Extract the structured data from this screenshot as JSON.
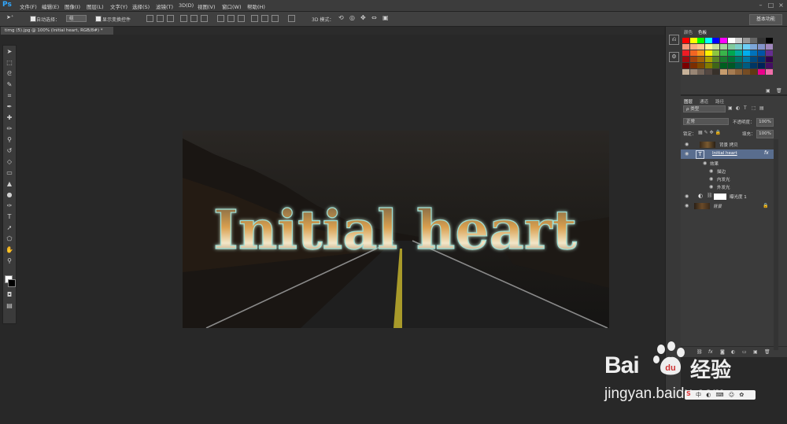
{
  "app": {
    "logo": "Ps"
  },
  "menu": [
    "文件(F)",
    "编辑(E)",
    "图像(I)",
    "图层(L)",
    "文字(Y)",
    "选择(S)",
    "滤镜(T)",
    "3D(D)",
    "视图(V)",
    "窗口(W)",
    "帮助(H)"
  ],
  "options": {
    "auto_select_label": "自动选择：",
    "auto_select_value": "组",
    "show_transform_label": "显示变换控件",
    "mode_3d_label": "3D 模式：",
    "workspace": "基本功能"
  },
  "document": {
    "tab_title": "timg (5).jpg @ 100% (Initial heart, RGB/8#) *"
  },
  "canvas": {
    "headline": "Initial heart"
  },
  "swatches": {
    "tabs": [
      "颜色",
      "色板"
    ],
    "colors": [
      "#ff0000",
      "#ffff00",
      "#00ff00",
      "#00ffff",
      "#0000ff",
      "#ff00ff",
      "#ffffff",
      "#cccccc",
      "#999999",
      "#666666",
      "#333333",
      "#000000",
      "#f7977a",
      "#fbad82",
      "#fdc68c",
      "#fff799",
      "#c6df9c",
      "#a4d49d",
      "#81ca9d",
      "#7bcdc9",
      "#6ccff7",
      "#7ca6d8",
      "#8293ca",
      "#a187be",
      "#ed1c24",
      "#f26522",
      "#f7941d",
      "#fff200",
      "#8dc63f",
      "#39b54a",
      "#00a651",
      "#00a99d",
      "#00aeef",
      "#0072bc",
      "#0054a6",
      "#662d91",
      "#9e0b0f",
      "#a0410d",
      "#a36209",
      "#aba000",
      "#598527",
      "#197b30",
      "#007236",
      "#00746b",
      "#0076a3",
      "#004a80",
      "#003471",
      "#32004b",
      "#790000",
      "#7b2e00",
      "#7d4900",
      "#827b00",
      "#406618",
      "#005e20",
      "#005826",
      "#005952",
      "#005b7f",
      "#003663",
      "#002157",
      "#440e62",
      "#c7b299",
      "#998675",
      "#736357",
      "#534741",
      "#37302a",
      "#c69c6d",
      "#a67c52",
      "#8c6239",
      "#754c24",
      "#603913",
      "#ec008c",
      "#f06eaa"
    ]
  },
  "layers": {
    "tabs": [
      "图层",
      "通道",
      "路径"
    ],
    "filter_kind": "类型",
    "blend_mode": "正常",
    "opacity_label": "不透明度：",
    "opacity_value": "100%",
    "lock_label": "锁定：",
    "fill_label": "填充：",
    "fill_value": "100%",
    "rows": {
      "bg_copy": "背景 拷贝",
      "text_layer": "Initial heart",
      "effects": "效果",
      "stroke": "描边",
      "inner_glow": "内发光",
      "outer_glow": "外发光",
      "brightness": "曝光度 1",
      "background": "背景"
    }
  },
  "watermark": {
    "brand_left": "Bai",
    "brand_right": "经验",
    "url": "jingyan.baidu.com"
  }
}
